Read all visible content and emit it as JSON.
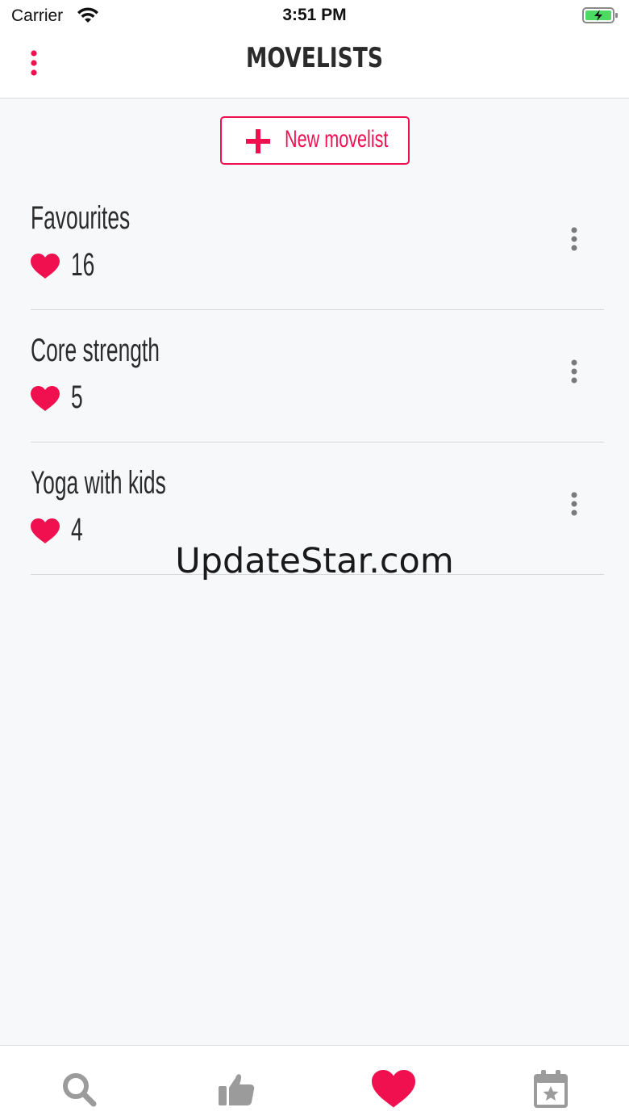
{
  "status_bar": {
    "carrier": "Carrier",
    "time": "3:51 PM",
    "icons": [
      "wifi-icon",
      "battery-charging-icon"
    ]
  },
  "header": {
    "title": "MOVELISTS",
    "menu_icon": "vertical-dots-icon"
  },
  "actions": {
    "new_movelist_label": "New movelist",
    "new_movelist_icon": "plus-icon"
  },
  "movelists": [
    {
      "title": "Favourites",
      "count": "16",
      "icon": "heart-icon"
    },
    {
      "title": "Core strength",
      "count": "5",
      "icon": "heart-icon"
    },
    {
      "title": "Yoga with kids",
      "count": "4",
      "icon": "heart-icon"
    }
  ],
  "watermark": "UpdateStar.com",
  "tab_bar": {
    "tabs": [
      {
        "icon": "search-icon",
        "active": false
      },
      {
        "icon": "thumbs-up-icon",
        "active": false
      },
      {
        "icon": "heart-icon",
        "active": true
      },
      {
        "icon": "calendar-star-icon",
        "active": false
      }
    ]
  },
  "colors": {
    "accent": "#f0104f",
    "text": "#2b2b2b",
    "inactive_icon": "#9b9b9b",
    "background": "#f7f8fa"
  }
}
